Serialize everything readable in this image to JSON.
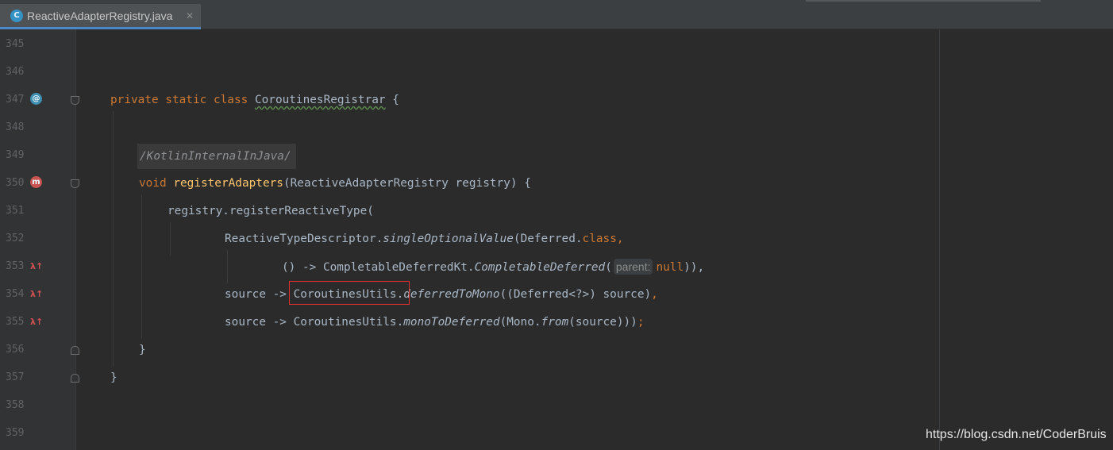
{
  "tab": {
    "icon": "java-class-icon",
    "icon_letter": "C",
    "title": "ReactiveAdapterRegistry.java",
    "close": "✕"
  },
  "gutter": {
    "line_numbers": [
      "345",
      "346",
      "347",
      "348",
      "349",
      "350",
      "351",
      "352",
      "353",
      "354",
      "355",
      "356",
      "357",
      "358",
      "359"
    ],
    "icons": {
      "implemented_letter": "@",
      "method_letter": "m",
      "lambda_symbol": "λ↑"
    }
  },
  "code": {
    "l347": {
      "kw1": "private static class ",
      "cls": "CoroutinesRegistrar",
      "rest": " {"
    },
    "l349": {
      "annotation": "/KotlinInternalInJava/"
    },
    "l350": {
      "kw": "void ",
      "fn": "registerAdapters",
      "rest": "(ReactiveAdapterRegistry registry) {"
    },
    "l351": {
      "text": "registry.registerReactiveType("
    },
    "l352": {
      "a": "ReactiveTypeDescriptor.",
      "b": "singleOptionalValue",
      "c": "(Deferred.",
      "d": "class",
      "e": ","
    },
    "l353": {
      "a": "() -> CompletableDeferredKt.",
      "b": "CompletableDeferred",
      "c": "(",
      "hint": "parent:",
      "d": "null",
      "e": ")),"
    },
    "l354": {
      "a": "source -> ",
      "b": "CoroutinesUtils.",
      "c": "deferredToMono",
      "d": "((Deferred<?>) source)",
      "e": ","
    },
    "l355": {
      "a": "source -> CoroutinesUtils.",
      "b": "monoToDeferred",
      "c": "(Mono.",
      "d": "from",
      "e": "(source)))",
      "f": ";"
    },
    "l356": {
      "text": "}"
    },
    "l357": {
      "text": "}"
    }
  },
  "watermark": "https://blog.csdn.net/CoderBruis"
}
